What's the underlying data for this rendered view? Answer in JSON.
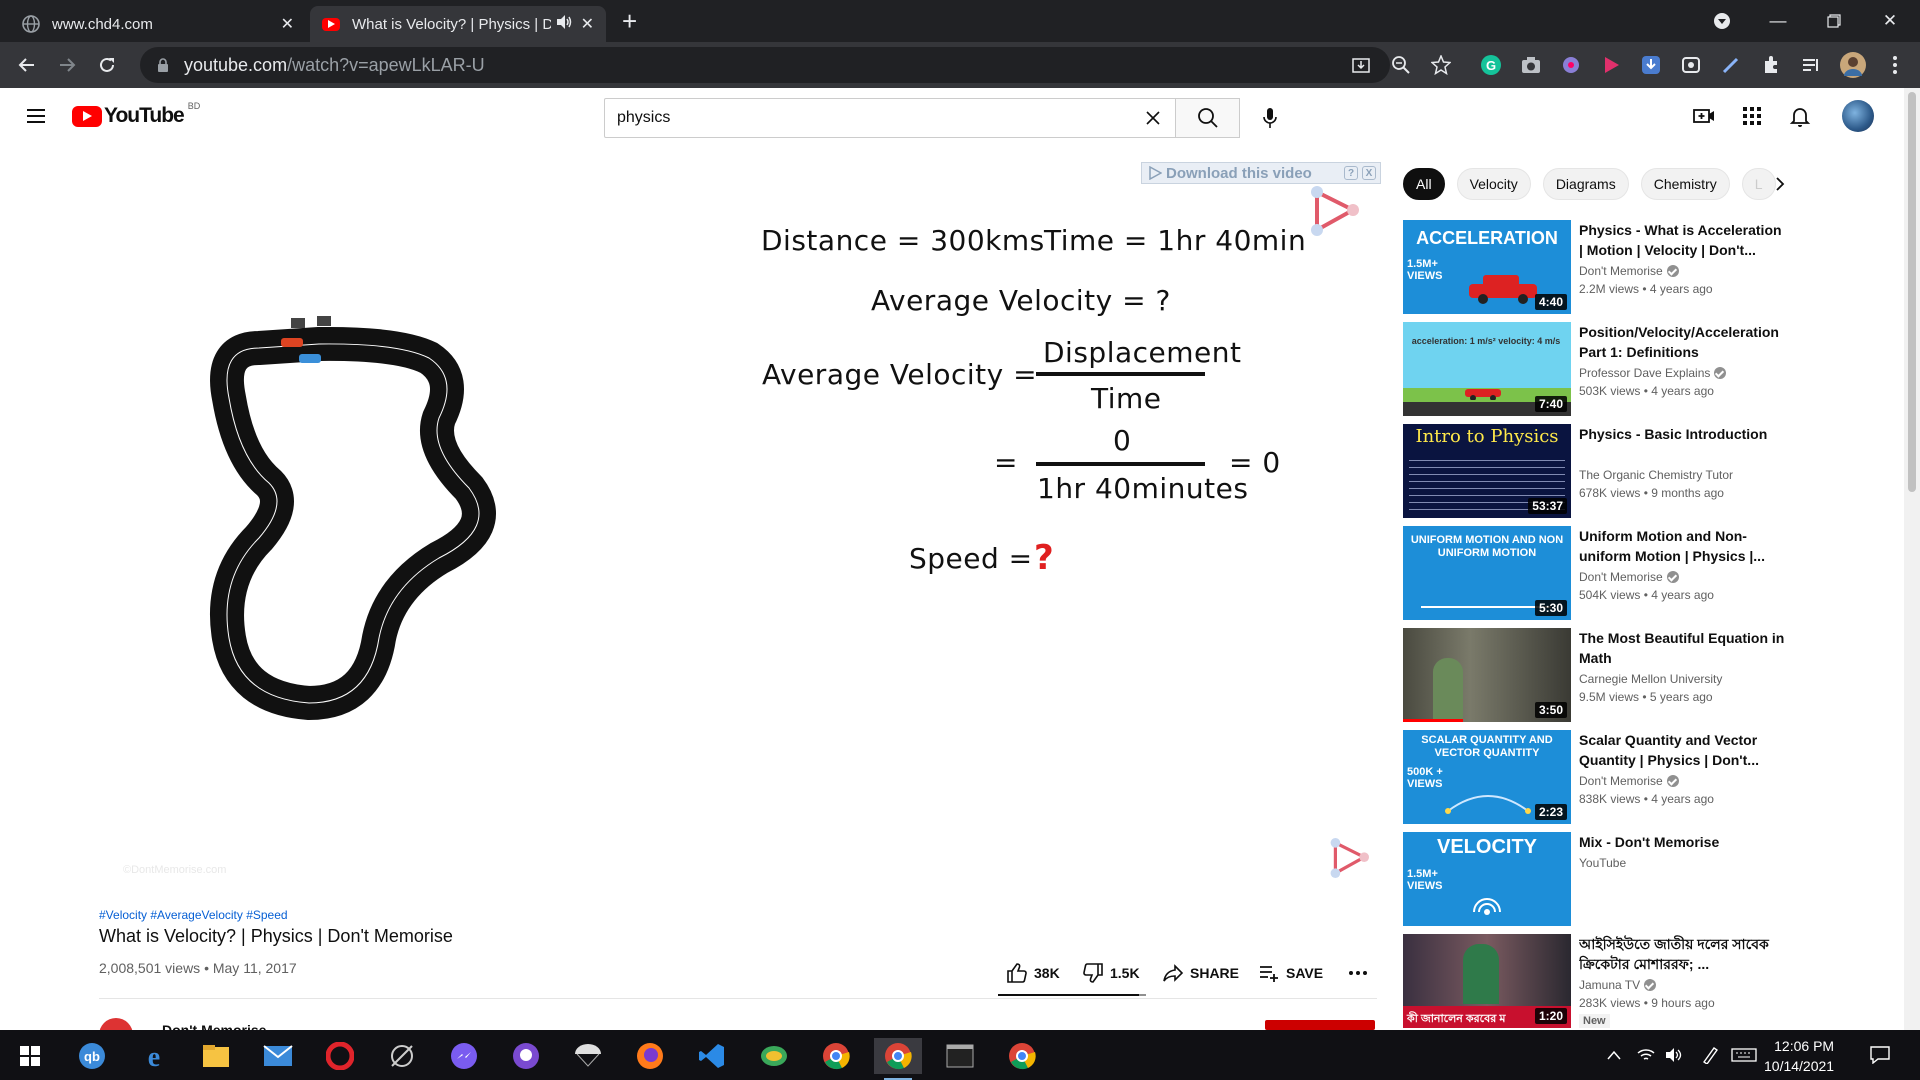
{
  "browser": {
    "tabs": [
      {
        "title": "www.chd4.com",
        "active": false
      },
      {
        "title": "What is Velocity? | Physics | D",
        "active": true
      }
    ],
    "url_main": "youtube.com",
    "url_rest": "/watch?v=apewLkLAR-U"
  },
  "youtube": {
    "logo_text": "YouTube",
    "country_code": "BD",
    "search_value": "physics",
    "overlay_download": "Download this video",
    "overlay_help": "?",
    "overlay_close": "X",
    "video": {
      "eq_distance": "Distance = 300kms",
      "eq_time": "Time = 1hr 40min",
      "eq_avg_q": "Average Velocity  =  ?",
      "eq_avg": "Average Velocity  =",
      "eq_num1": "Displacement",
      "eq_den1": "Time",
      "eq_eq2": "=",
      "eq_num2": "0",
      "eq_den2": "1hr 40minutes",
      "eq_res": "= 0",
      "eq_speed": "Speed  =",
      "eq_qmark": "?",
      "watermark": "©DontMemorise.com"
    },
    "hashtags": "#Velocity #AverageVelocity #Speed",
    "title": "What is Velocity? | Physics | Don't Memorise",
    "meta": "2,008,501 views • May 11, 2017",
    "likes": "38K",
    "dislikes": "1.5K",
    "share": "SHARE",
    "save": "SAVE",
    "like_ratio": 0.95,
    "channel_peek": "Don't Memorise",
    "chips": [
      "All",
      "Velocity",
      "Diagrams",
      "Chemistry",
      "L"
    ],
    "related": [
      {
        "title": "Physics - What is Acceleration | Motion | Velocity | Don't...",
        "channel": "Don't Memorise",
        "verified": true,
        "stats": "2.2M views • 4 years ago",
        "duration": "4:40",
        "thumb_text": "ACCELERATION",
        "thumb_badge": "1.5M+\nVIEWS",
        "new": false
      },
      {
        "title": "Position/Velocity/Acceleration Part 1: Definitions",
        "channel": "Professor Dave Explains",
        "verified": true,
        "stats": "503K views • 4 years ago",
        "duration": "7:40",
        "thumb_text": "acceleration: 1 m/s²   velocity: 4 m/s",
        "new": false
      },
      {
        "title": "Physics - Basic Introduction",
        "channel": "The Organic Chemistry Tutor",
        "verified": false,
        "stats": "678K views • 9 months ago",
        "duration": "53:37",
        "thumb_text": "Intro to Physics",
        "new": false
      },
      {
        "title": "Uniform Motion and Non-uniform Motion | Physics |...",
        "channel": "Don't Memorise",
        "verified": true,
        "stats": "504K views • 4 years ago",
        "duration": "5:30",
        "thumb_text": "UNIFORM MOTION AND NON UNIFORM MOTION",
        "new": false
      },
      {
        "title": "The Most Beautiful Equation in Math",
        "channel": "Carnegie Mellon University",
        "verified": false,
        "stats": "9.5M views • 5 years ago",
        "duration": "3:50",
        "thumb_text": "",
        "new": false
      },
      {
        "title": "Scalar Quantity and Vector Quantity | Physics | Don't...",
        "channel": "Don't Memorise",
        "verified": true,
        "stats": "838K views • 4 years ago",
        "duration": "2:23",
        "thumb_text": "SCALAR QUANTITY AND VECTOR QUANTITY",
        "thumb_badge": "500K +\nVIEWS",
        "new": false
      },
      {
        "title": "Mix - Don't Memorise",
        "channel": "YouTube",
        "verified": false,
        "stats": "",
        "duration": "",
        "thumb_text": "VELOCITY",
        "thumb_badge": "1.5M+\nVIEWS",
        "new": false
      },
      {
        "title": "আইসিইউতে জাতীয় দলের সাবেক ক্রিকেটার মোশাররফ; ...",
        "channel": "Jamuna TV",
        "verified": true,
        "stats": "283K views • 9 hours ago",
        "duration": "1:20",
        "thumb_text": "কী জানালেন করবের ম",
        "new": true,
        "new_label": "New"
      }
    ]
  },
  "taskbar": {
    "time": "12:06 PM",
    "date": "10/14/2021"
  }
}
